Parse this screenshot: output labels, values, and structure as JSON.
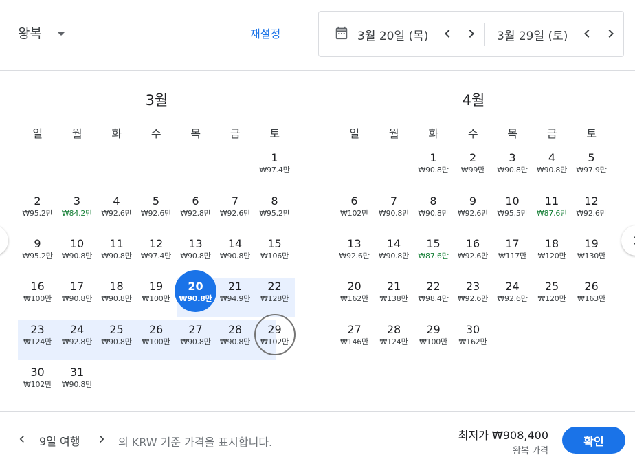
{
  "header": {
    "trip_type": "왕복",
    "reset_label": "재설정",
    "depart_date": "3월 20일 (목)",
    "return_date": "3월 29일 (토)"
  },
  "weekdays": [
    "일",
    "월",
    "화",
    "수",
    "목",
    "금",
    "토"
  ],
  "months": [
    {
      "title": "3월",
      "days": [
        {
          "d": "1",
          "p": "₩97.4만"
        },
        {
          "d": "2",
          "p": "₩95.2만"
        },
        {
          "d": "3",
          "p": "₩84.2만",
          "low": true
        },
        {
          "d": "4",
          "p": "₩92.6만"
        },
        {
          "d": "5",
          "p": "₩92.6만"
        },
        {
          "d": "6",
          "p": "₩92.8만"
        },
        {
          "d": "7",
          "p": "₩92.6만"
        },
        {
          "d": "8",
          "p": "₩95.2만"
        },
        {
          "d": "9",
          "p": "₩95.2만"
        },
        {
          "d": "10",
          "p": "₩90.8만"
        },
        {
          "d": "11",
          "p": "₩90.8만"
        },
        {
          "d": "12",
          "p": "₩97.4만"
        },
        {
          "d": "13",
          "p": "₩90.8만"
        },
        {
          "d": "14",
          "p": "₩90.8만"
        },
        {
          "d": "15",
          "p": "₩106만"
        },
        {
          "d": "16",
          "p": "₩100만"
        },
        {
          "d": "17",
          "p": "₩90.8만"
        },
        {
          "d": "18",
          "p": "₩90.8만"
        },
        {
          "d": "19",
          "p": "₩100만"
        },
        {
          "d": "20",
          "p": "₩90.8만"
        },
        {
          "d": "21",
          "p": "₩94.9만"
        },
        {
          "d": "22",
          "p": "₩128만"
        },
        {
          "d": "23",
          "p": "₩124만"
        },
        {
          "d": "24",
          "p": "₩92.8만"
        },
        {
          "d": "25",
          "p": "₩90.8만"
        },
        {
          "d": "26",
          "p": "₩100만"
        },
        {
          "d": "27",
          "p": "₩90.8만"
        },
        {
          "d": "28",
          "p": "₩90.8만"
        },
        {
          "d": "29",
          "p": "₩102만"
        },
        {
          "d": "30",
          "p": "₩102만"
        },
        {
          "d": "31",
          "p": "₩90.8만"
        }
      ]
    },
    {
      "title": "4월",
      "days": [
        {
          "d": "1",
          "p": "₩90.8만"
        },
        {
          "d": "2",
          "p": "₩99만"
        },
        {
          "d": "3",
          "p": "₩90.8만"
        },
        {
          "d": "4",
          "p": "₩90.8만"
        },
        {
          "d": "5",
          "p": "₩97.9만"
        },
        {
          "d": "6",
          "p": "₩102만"
        },
        {
          "d": "7",
          "p": "₩90.8만"
        },
        {
          "d": "8",
          "p": "₩90.8만"
        },
        {
          "d": "9",
          "p": "₩92.6만"
        },
        {
          "d": "10",
          "p": "₩95.5만"
        },
        {
          "d": "11",
          "p": "₩87.6만",
          "low": true
        },
        {
          "d": "12",
          "p": "₩92.6만"
        },
        {
          "d": "13",
          "p": "₩92.6만"
        },
        {
          "d": "14",
          "p": "₩90.8만"
        },
        {
          "d": "15",
          "p": "₩87.6만",
          "low": true
        },
        {
          "d": "16",
          "p": "₩92.6만"
        },
        {
          "d": "17",
          "p": "₩117만"
        },
        {
          "d": "18",
          "p": "₩120만"
        },
        {
          "d": "19",
          "p": "₩130만"
        },
        {
          "d": "20",
          "p": "₩162만"
        },
        {
          "d": "21",
          "p": "₩138만"
        },
        {
          "d": "22",
          "p": "₩98.4만"
        },
        {
          "d": "23",
          "p": "₩92.6만"
        },
        {
          "d": "24",
          "p": "₩92.6만"
        },
        {
          "d": "25",
          "p": "₩120만"
        },
        {
          "d": "26",
          "p": "₩163만"
        },
        {
          "d": "27",
          "p": "₩146만"
        },
        {
          "d": "28",
          "p": "₩124만"
        },
        {
          "d": "29",
          "p": "₩100만"
        },
        {
          "d": "30",
          "p": "₩162만"
        }
      ]
    }
  ],
  "footer": {
    "trip_length": "9일 여행",
    "note": "의 KRW 기준 가격을 표시합니다.",
    "lowest_price": "최저가 ₩908,400",
    "lowest_sub": "왕복 가격",
    "confirm_label": "확인"
  },
  "colors": {
    "accent": "#1a73e8",
    "range": "#e8f0fe",
    "low_price": "#188038"
  }
}
